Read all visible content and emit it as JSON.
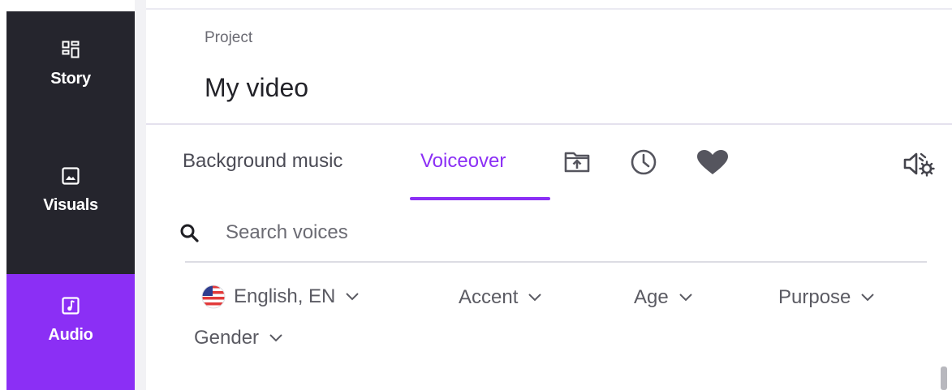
{
  "sidebar": {
    "items": [
      {
        "label": "Story",
        "icon": "story-grid-icon",
        "active": false
      },
      {
        "label": "Visuals",
        "icon": "image-icon",
        "active": false
      },
      {
        "label": "Audio",
        "icon": "music-note-icon",
        "active": true
      }
    ],
    "bg_color": "#25252d",
    "active_color": "#8b2ff5"
  },
  "header": {
    "label": "Project",
    "title": "My video"
  },
  "tabs": {
    "items": [
      {
        "label": "Background music",
        "active": false
      },
      {
        "label": "Voiceover",
        "active": true
      }
    ],
    "icon_tabs": [
      "upload-folder-icon",
      "history-clock-icon",
      "favorites-heart-icon"
    ],
    "settings_icon": "voice-settings-icon",
    "accent_color": "#8b2ff5"
  },
  "search": {
    "placeholder": "Search voices",
    "value": ""
  },
  "filters": {
    "language": {
      "label": "English, EN",
      "flag": "us-flag-icon"
    },
    "accent": {
      "label": "Accent"
    },
    "age": {
      "label": "Age"
    },
    "purpose": {
      "label": "Purpose"
    },
    "gender": {
      "label": "Gender"
    }
  }
}
